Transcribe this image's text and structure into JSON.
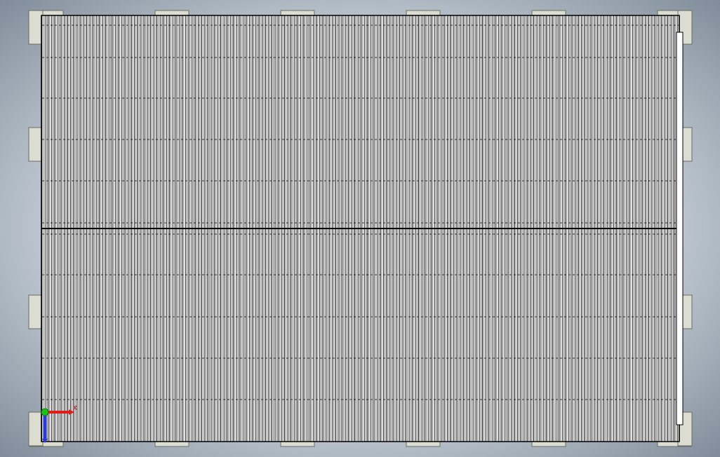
{
  "viewport": {
    "background_center": "#eef2f6",
    "background_edge": "#7f8c99"
  },
  "model": {
    "kind": "rectangular-panel-assembly",
    "panel_fill": "#ffffff",
    "line_color": "#000000",
    "bracket_fill": "#dcddd2",
    "bracket_stroke": "#6a6a60"
  },
  "triad": {
    "x_axis_color": "#e21b1b",
    "y_axis_color": "#17c417",
    "z_axis_color": "#2b3ad6",
    "x_label": "X"
  }
}
